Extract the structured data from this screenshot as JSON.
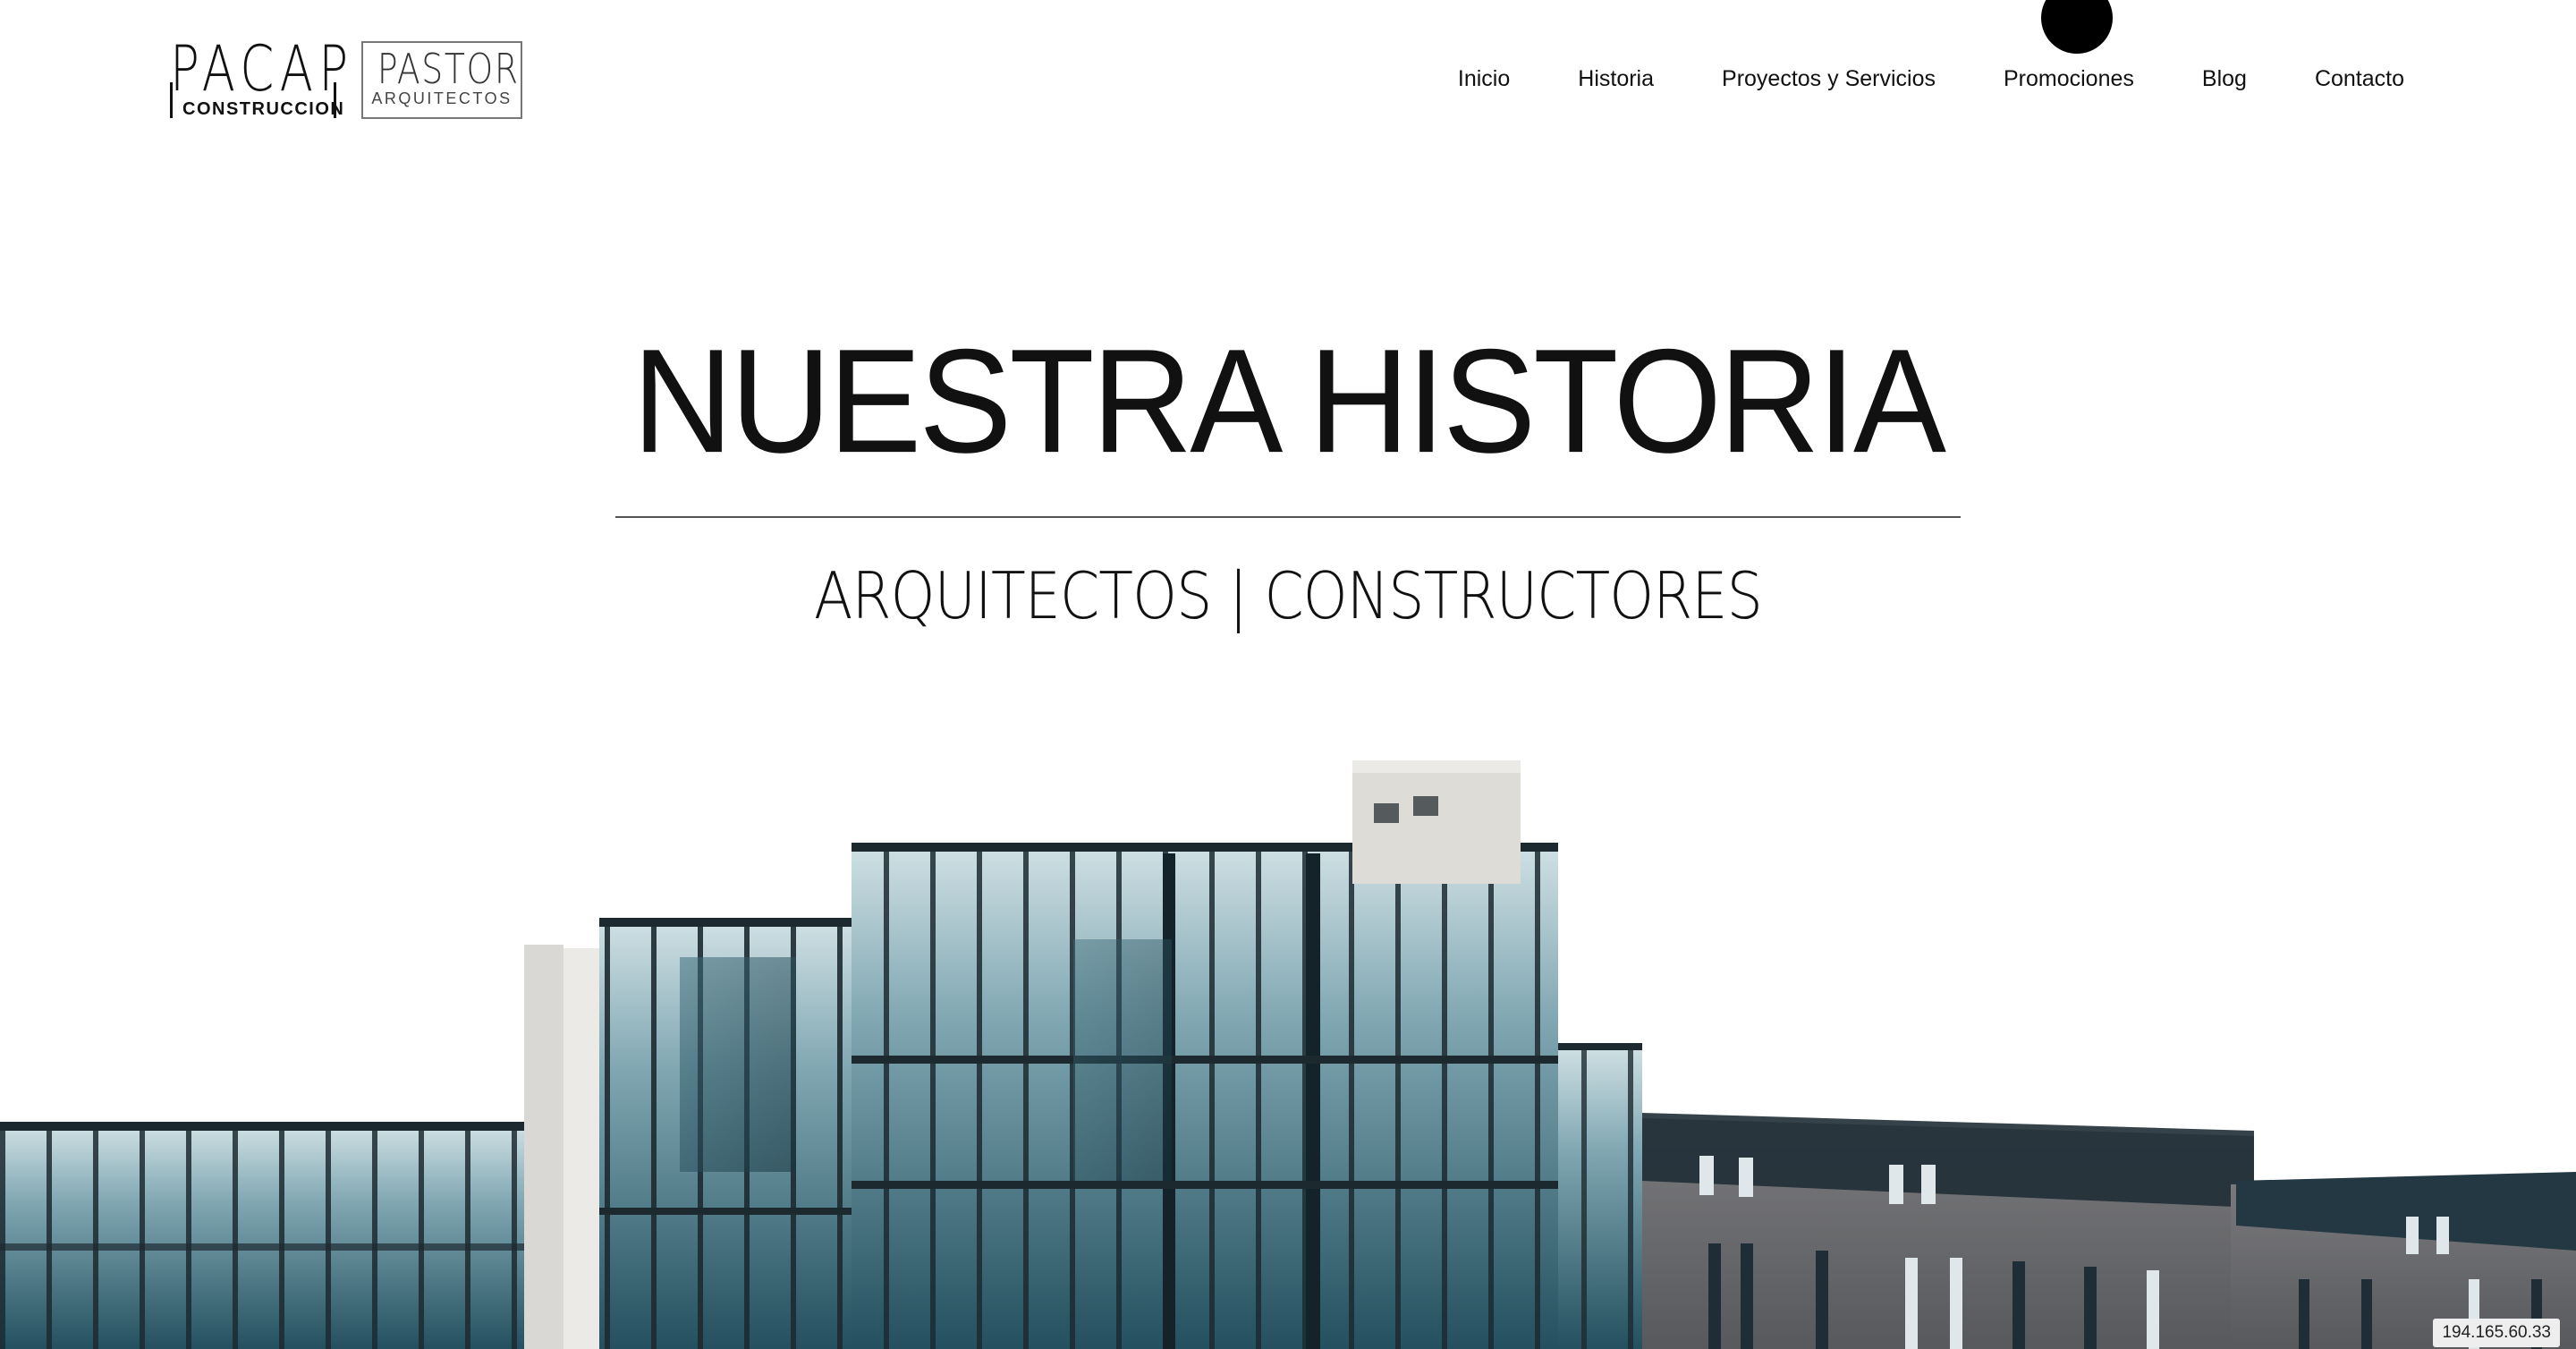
{
  "header": {
    "logo_primary": {
      "word": "PACAP",
      "tagline": "CONSTRUCCION"
    },
    "logo_secondary": {
      "word": "PASTOR",
      "tagline": "ARQUITECTOS"
    },
    "nav": [
      "Inicio",
      "Historia",
      "Proyectos y Servicios",
      "Promociones",
      "Blog",
      "Contacto"
    ]
  },
  "hero": {
    "title": "NUESTRA HISTORIA",
    "subtitle": "ARQUITECTOS | CONSTRUCTORES"
  },
  "ip_address": "194.165.60.33",
  "colors": {
    "text": "#111111",
    "glass": "#2e5f6e",
    "glass_light": "#8fb3bd",
    "concrete": "#e4e2dd",
    "brick": "#6f6f72",
    "frame": "#1c2a30"
  }
}
